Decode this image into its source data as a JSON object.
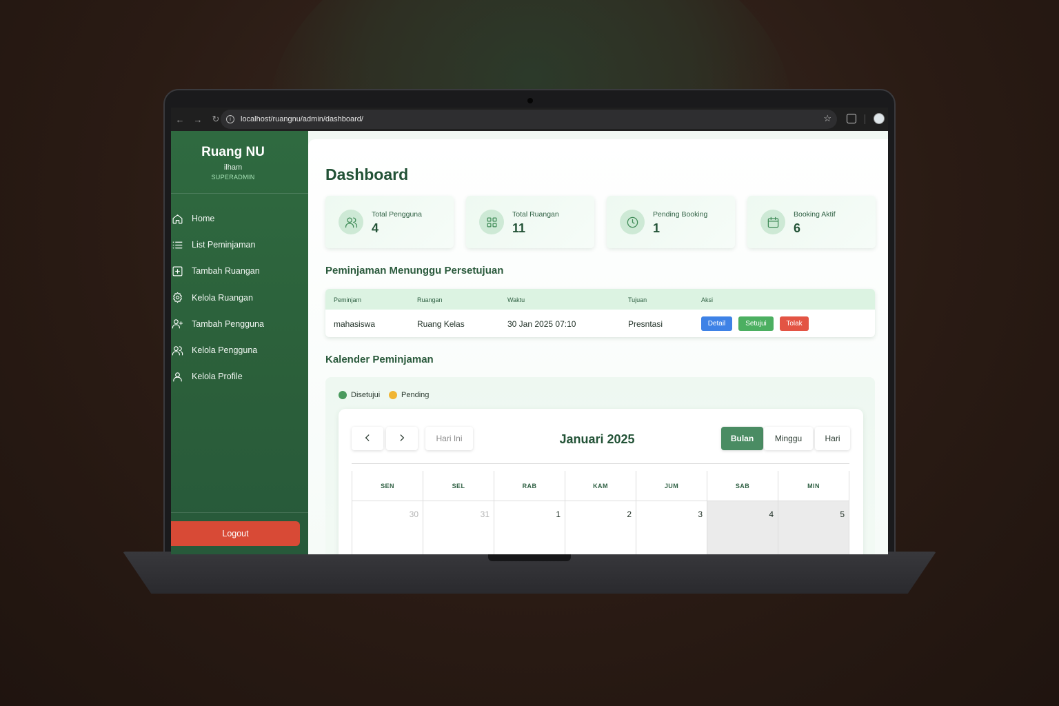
{
  "browser": {
    "url": "localhost/ruangnu/admin/dashboard/"
  },
  "sidebar": {
    "brand": "Ruang NU",
    "username": "ilham",
    "role": "SUPERADMIN",
    "items": [
      {
        "label": "Home",
        "icon": "home-icon"
      },
      {
        "label": "List Peminjaman",
        "icon": "list-icon"
      },
      {
        "label": "Tambah Ruangan",
        "icon": "plus-square-icon"
      },
      {
        "label": "Kelola Ruangan",
        "icon": "gear-icon"
      },
      {
        "label": "Tambah Pengguna",
        "icon": "user-plus-icon"
      },
      {
        "label": "Kelola Pengguna",
        "icon": "users-icon"
      },
      {
        "label": "Kelola Profile",
        "icon": "user-icon"
      }
    ],
    "logout_label": "Logout"
  },
  "main": {
    "title": "Dashboard",
    "stats": [
      {
        "label": "Total Pengguna",
        "value": "4",
        "icon": "users-icon"
      },
      {
        "label": "Total Ruangan",
        "value": "11",
        "icon": "grid-icon"
      },
      {
        "label": "Pending Booking",
        "value": "1",
        "icon": "clock-icon"
      },
      {
        "label": "Booking Aktif",
        "value": "6",
        "icon": "calendar-icon"
      }
    ],
    "pending_section_title": "Peminjaman Menunggu Persetujuan",
    "table": {
      "headers": [
        "Peminjam",
        "Ruangan",
        "Waktu",
        "Tujuan",
        "Aksi"
      ],
      "rows": [
        {
          "peminjam": "mahasiswa",
          "ruangan": "Ruang Kelas",
          "waktu": "30 Jan 2025 07:10",
          "tujuan": "Presntasi"
        }
      ],
      "actions": {
        "detail": "Detail",
        "approve": "Setujui",
        "reject": "Tolak"
      }
    },
    "calendar_section_title": "Kalender Peminjaman",
    "calendar": {
      "legend": [
        {
          "label": "Disetujui",
          "color": "#4a9a5e"
        },
        {
          "label": "Pending",
          "color": "#f0b533"
        }
      ],
      "today_label": "Hari Ini",
      "month_title": "Januari 2025",
      "views": [
        "Bulan",
        "Minggu",
        "Hari"
      ],
      "active_view": "Bulan",
      "day_headers": [
        "SEN",
        "SEL",
        "RAB",
        "KAM",
        "JUM",
        "SAB",
        "MIN"
      ],
      "first_week": [
        "30",
        "31",
        "1",
        "2",
        "3",
        "4",
        "5"
      ]
    }
  },
  "colors": {
    "sidebar": "#2f6a40",
    "accent": "#225236",
    "logout": "#d84a36",
    "detail_btn": "#3e82e6",
    "approve_btn": "#4caf61",
    "reject_btn": "#e35444"
  }
}
